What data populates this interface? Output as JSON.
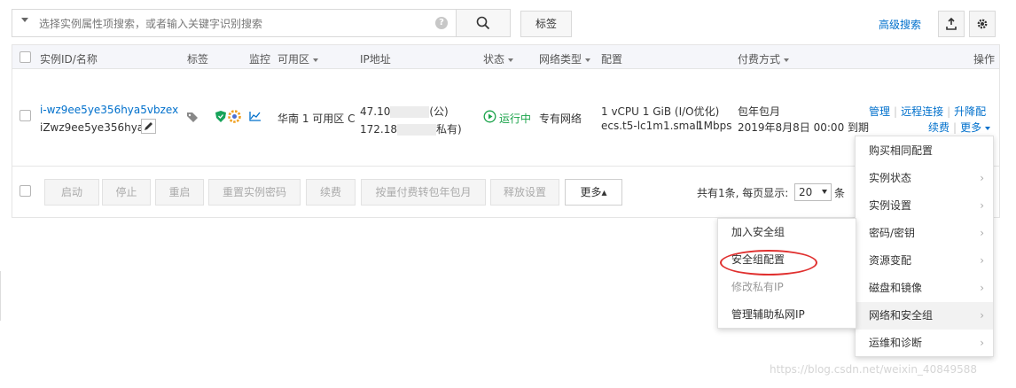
{
  "search": {
    "placeholder": "选择实例属性项搜索，或者输入关键字识别搜索",
    "tag_button": "标签",
    "advanced": "高级搜索"
  },
  "columns": [
    "实例ID/名称",
    "标签",
    "监控",
    "可用区",
    "IP地址",
    "状态",
    "网络类型",
    "配置",
    "付费方式",
    "操作"
  ],
  "row": {
    "id": "i-wz9ee5ye356hya5vbzex",
    "name": "iZwz9ee5ye356hya...",
    "zone": "华南 1 可用区 C",
    "ip_public": "47.10",
    "ip_public_suffix": "(公)",
    "ip_private": "172.18",
    "ip_private_suffix": "私有)",
    "status": "运行中",
    "network": "专有网络",
    "config_line1": "1 vCPU 1 GiB (I/O优化)",
    "config_line2": "ecs.t5-lc1m1.small",
    "bandwidth": "1Mbps",
    "billing": "包年包月",
    "expiry": "2019年8月8日 00:00 到期",
    "actions": {
      "manage": "管理",
      "remote": "远程连接",
      "upgrade": "升降配",
      "renew": "续费",
      "more": "更多"
    }
  },
  "footer": {
    "buttons": [
      "启动",
      "停止",
      "重启",
      "重置实例密码",
      "续费",
      "按量付费转包年包月",
      "释放设置"
    ],
    "more": "更多",
    "more_arrow": "▴",
    "pagination_text": "共有1条, 每页显示:",
    "page_size": "20",
    "page_unit": "条"
  },
  "menu_main": [
    "购买相同配置",
    "实例状态",
    "实例设置",
    "密码/密钥",
    "资源变配",
    "磁盘和镜像",
    "网络和安全组",
    "运维和诊断"
  ],
  "menu_sub": [
    "加入安全组",
    "安全组配置",
    "修改私有IP",
    "管理辅助私网IP"
  ],
  "watermark": "https://blog.csdn.net/weixin_40849588",
  "colors": {
    "link": "#0070cc",
    "running": "#1aa34a",
    "annotation": "#e0302f"
  }
}
